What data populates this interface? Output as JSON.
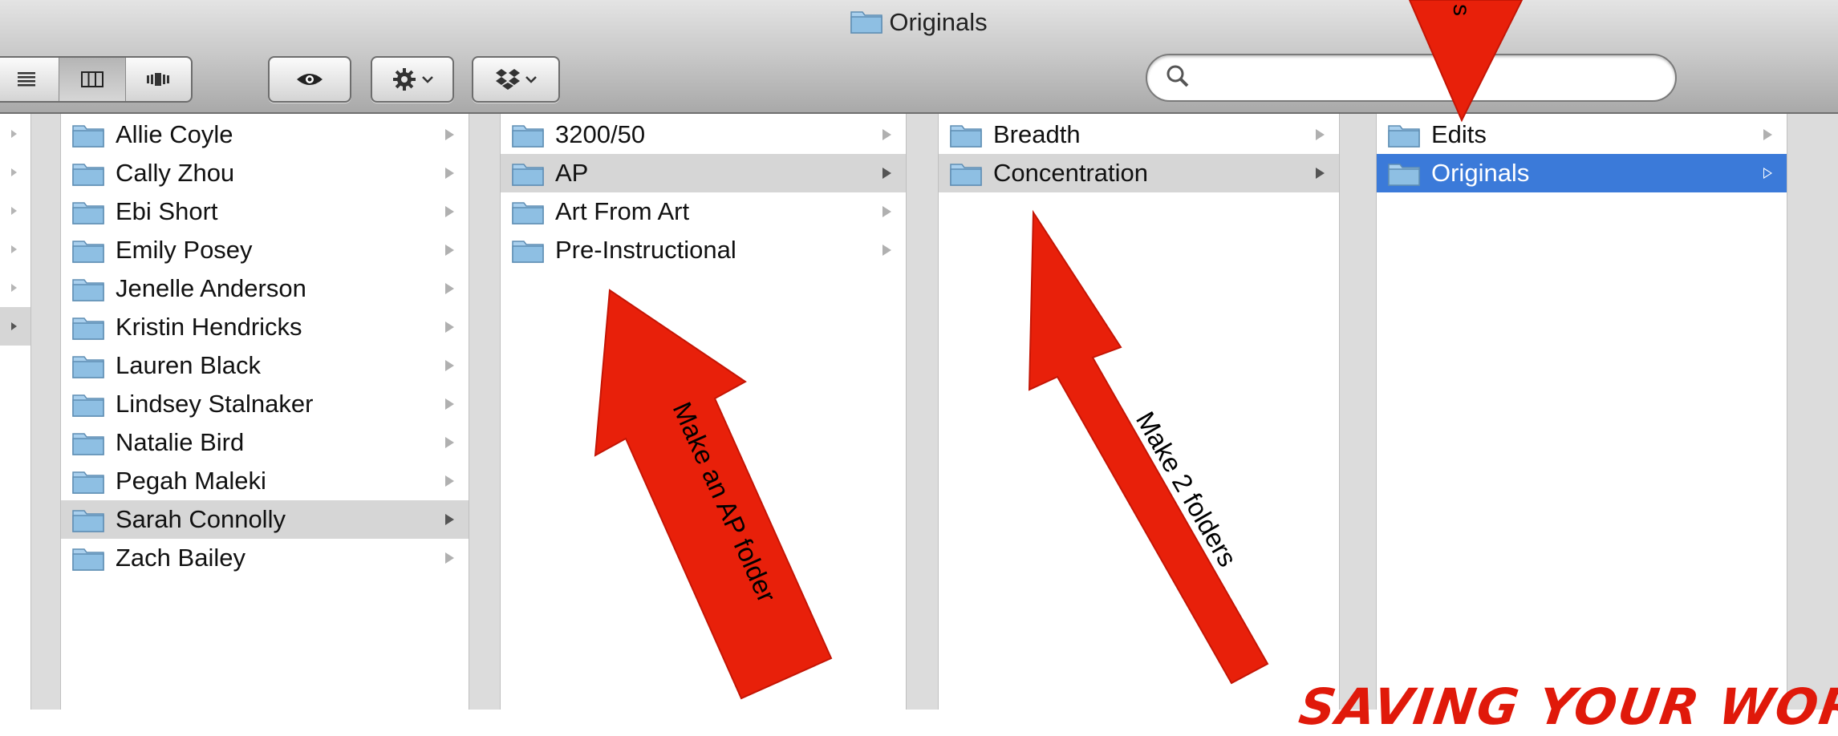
{
  "window": {
    "title": "Originals"
  },
  "toolbar": {
    "view_list_icon": "list-view-icon",
    "view_column_icon": "column-view-icon",
    "view_coverflow_icon": "coverflow-view-icon",
    "quicklook_icon": "eye-icon",
    "action_icon": "gear-icon",
    "dropbox_icon": "dropbox-icon",
    "search": {
      "placeholder": "",
      "value": ""
    }
  },
  "columns": [
    {
      "items": [
        {
          "label": "Allie Coyle"
        },
        {
          "label": "Cally Zhou"
        },
        {
          "label": "Ebi Short"
        },
        {
          "label": "Emily Posey"
        },
        {
          "label": "Jenelle Anderson"
        },
        {
          "label": "Kristin Hendricks"
        },
        {
          "label": "Lauren Black"
        },
        {
          "label": "Lindsey Stalnaker"
        },
        {
          "label": "Natalie Bird"
        },
        {
          "label": "Pegah Maleki"
        },
        {
          "label": "Sarah Connolly",
          "selected": true
        },
        {
          "label": "Zach Bailey"
        }
      ]
    },
    {
      "items": [
        {
          "label": "3200/50"
        },
        {
          "label": "AP",
          "selected": true
        },
        {
          "label": "Art From Art"
        },
        {
          "label": "Pre-Instructional"
        }
      ]
    },
    {
      "items": [
        {
          "label": "Breadth"
        },
        {
          "label": "Concentration",
          "selected": true
        }
      ]
    },
    {
      "items": [
        {
          "label": "Edits"
        },
        {
          "label": "Originals",
          "selected": true,
          "active": true
        }
      ]
    }
  ],
  "annotations": {
    "arrow1_text": "Make an AP folder",
    "arrow2_text": "Make 2 folders",
    "arrow3_text": "s",
    "bottom_text": "SAVING YOUR WOR",
    "arrow_color": "#e8200a"
  },
  "colors": {
    "selection_blue": "#3b7ad9",
    "selection_gray": "#d6d6d6",
    "folder_blue": "#8ebfe3"
  }
}
